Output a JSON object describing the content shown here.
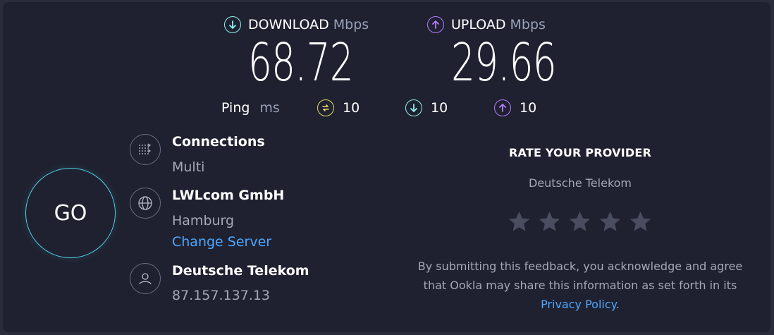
{
  "download": {
    "label": "DOWNLOAD",
    "unit": "Mbps",
    "value": "68.72",
    "icon": "download-circle-icon",
    "color": "#8ff1f0"
  },
  "upload": {
    "label": "UPLOAD",
    "unit": "Mbps",
    "value": "29.66",
    "icon": "upload-circle-icon",
    "color": "#b57cff"
  },
  "ping": {
    "label": "Ping",
    "unit": "ms",
    "idle": "10",
    "download": "10",
    "upload": "10",
    "idle_color": "#e8d96a",
    "download_color": "#8ff1f0",
    "upload_color": "#b57cff"
  },
  "go_button": {
    "label": "GO",
    "ring_color": "#4fd1e3"
  },
  "connections": {
    "title": "Connections",
    "value": "Multi",
    "icon": "connections-icon"
  },
  "server": {
    "name": "LWLcom GmbH",
    "location": "Hamburg",
    "change_label": "Change Server",
    "icon": "globe-icon"
  },
  "isp": {
    "name": "Deutsche Telekom",
    "ip": "87.157.137.13",
    "icon": "user-icon"
  },
  "rating": {
    "title": "RATE YOUR PROVIDER",
    "provider": "Deutsche Telekom",
    "stars": 5,
    "disclaimer_line1": "By submitting this feedback, you acknowledge and agree",
    "disclaimer_line2": "that Ookla may share this information as set forth in its",
    "privacy_link": "Privacy Policy",
    "privacy_suffix": "."
  }
}
